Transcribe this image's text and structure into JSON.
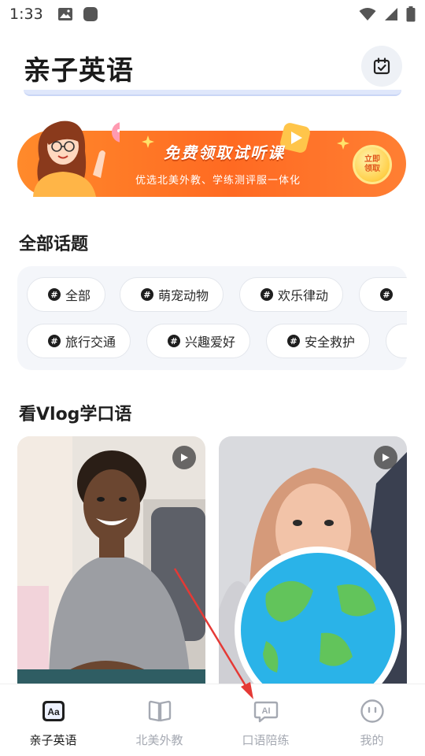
{
  "status_bar": {
    "time": "1:33"
  },
  "header": {
    "title": "亲子英语",
    "calendar_icon": "calendar-check-icon"
  },
  "banner": {
    "title": "免费领取试听课",
    "subtitle": "优选北美外教、学练测评服一体化",
    "cta": "立即领取"
  },
  "topics": {
    "title": "全部话题",
    "row1": [
      "全部",
      "萌宠动物",
      "欢乐律动"
    ],
    "row2": [
      "旅行交通",
      "兴趣爱好",
      "安全救护"
    ]
  },
  "vlog": {
    "title": "看Vlog学口语"
  },
  "nav": {
    "items": [
      {
        "label": "亲子英语",
        "icon": "aa-book-icon",
        "active": true
      },
      {
        "label": "北美外教",
        "icon": "open-book-icon",
        "active": false
      },
      {
        "label": "口语陪练",
        "icon": "ai-chat-icon",
        "active": false
      },
      {
        "label": "我的",
        "icon": "smiley-icon",
        "active": false
      }
    ]
  },
  "colors": {
    "accent": "#ff6a22",
    "active_nav": "#1e1e1e",
    "inactive_nav": "#a5a9b2",
    "arrow": "#e53935"
  }
}
